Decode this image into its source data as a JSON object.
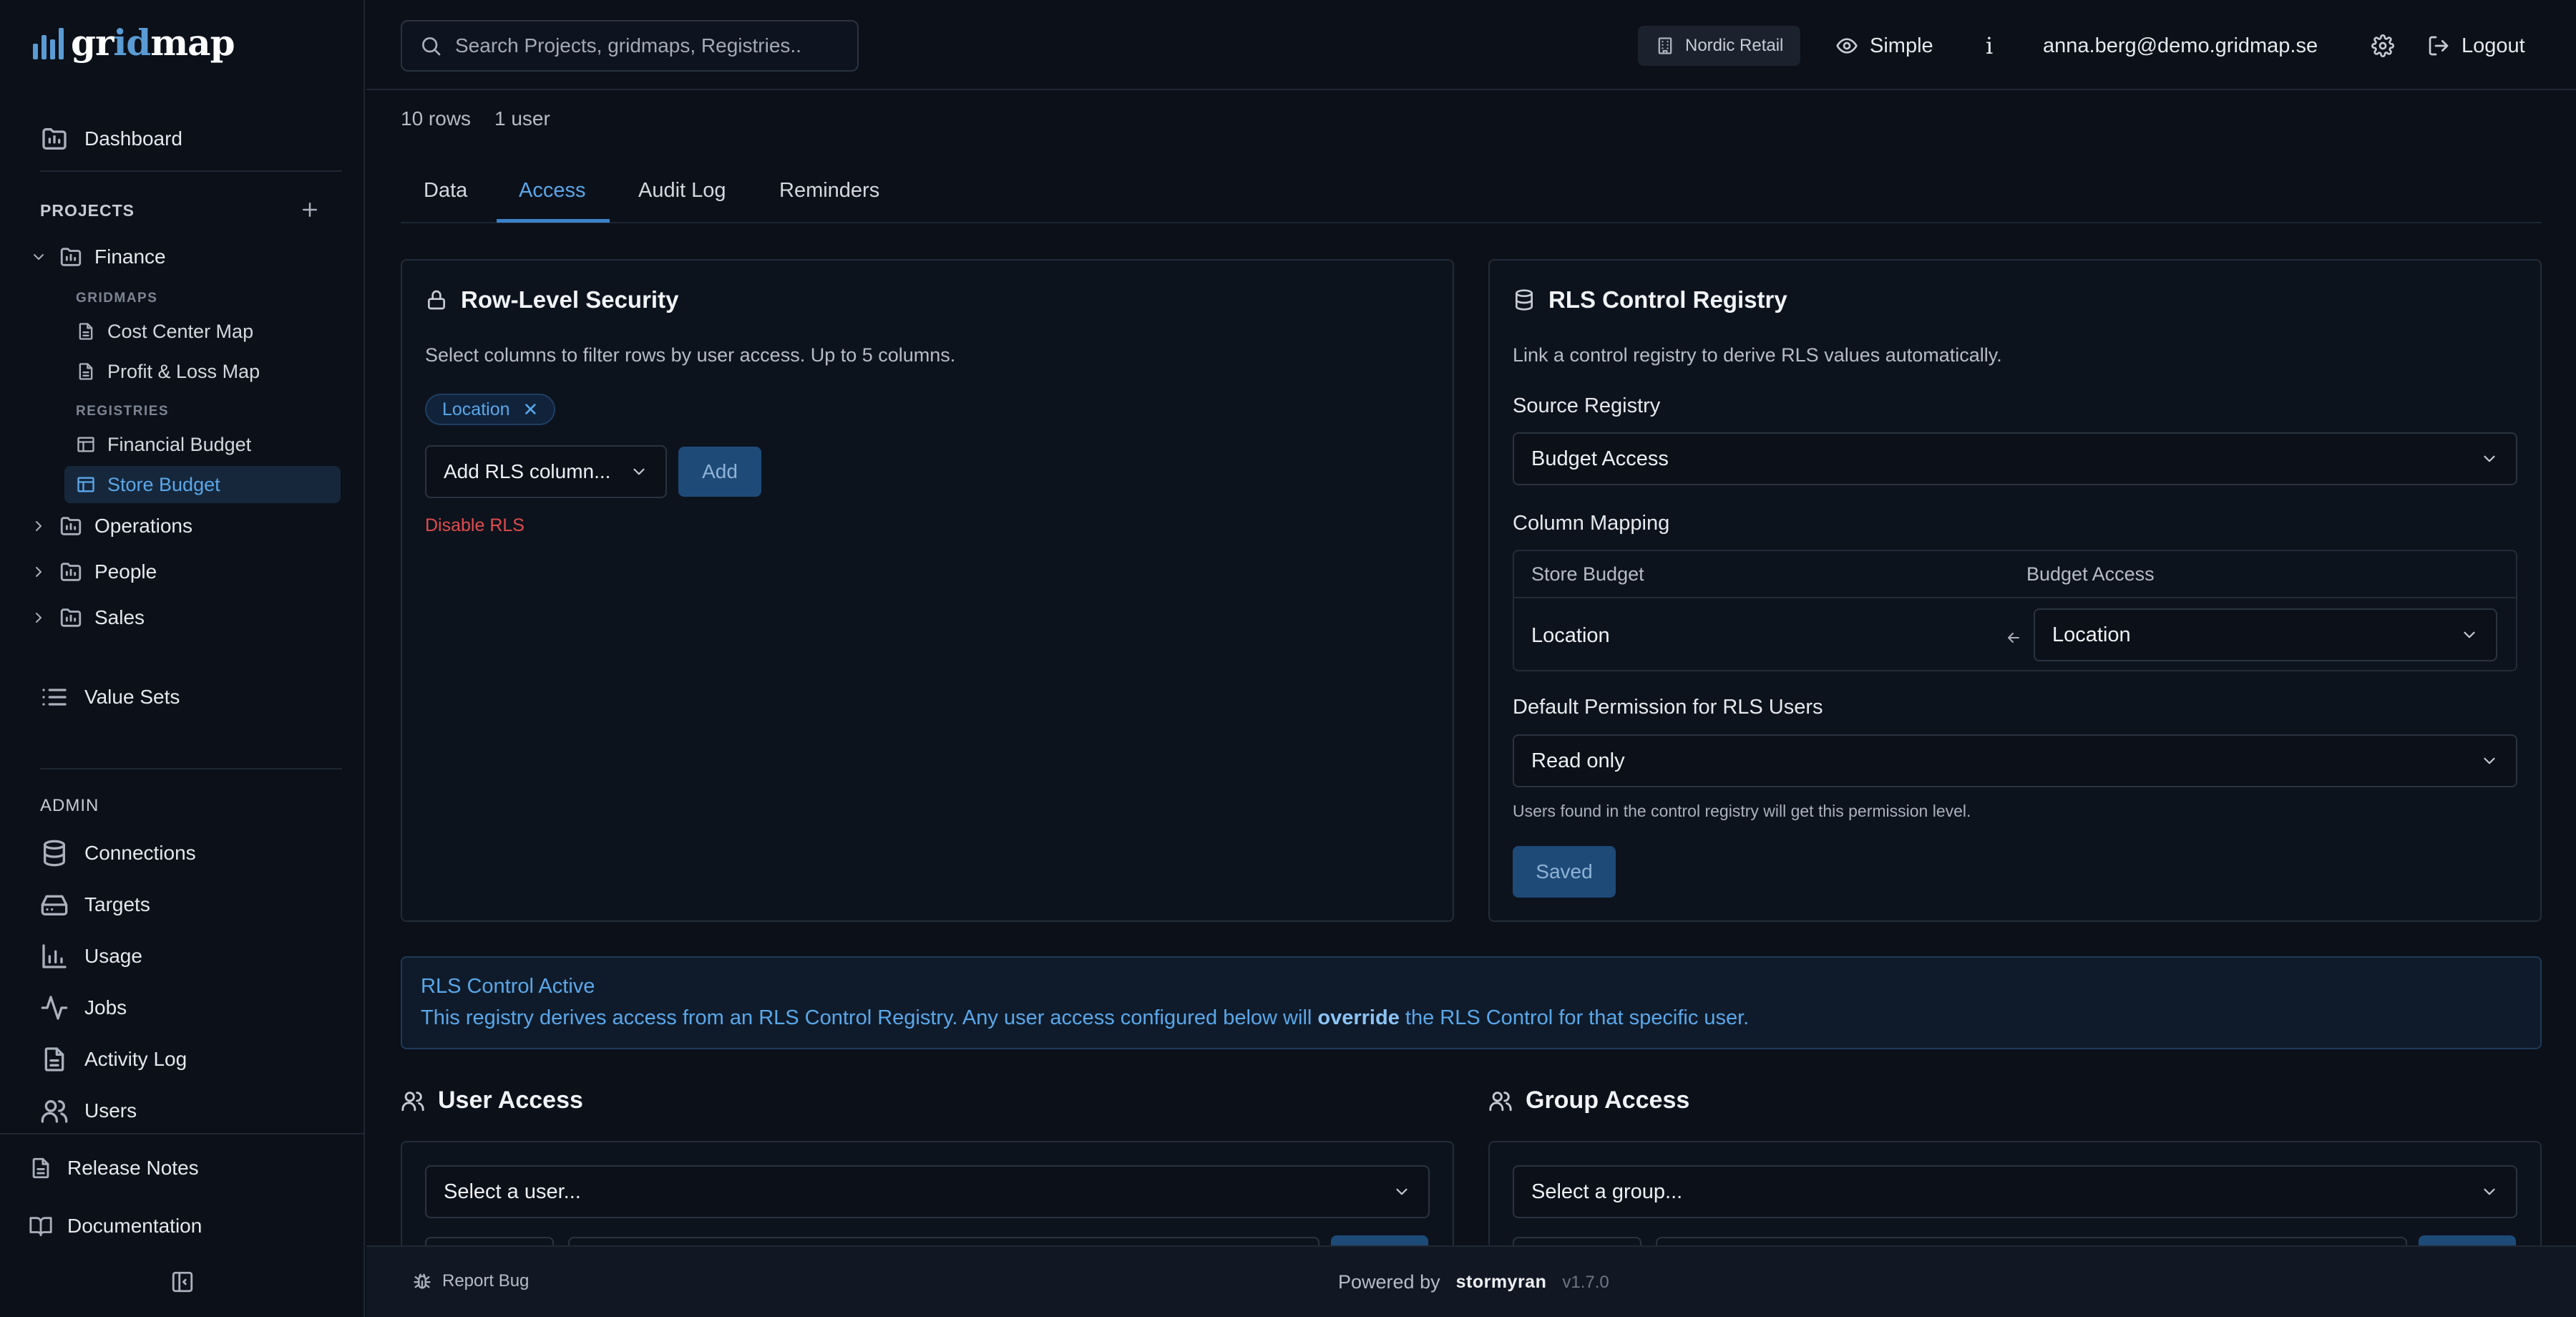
{
  "app": {
    "logo_part1": "gr",
    "logo_accent": "id",
    "logo_part2": "map"
  },
  "header": {
    "search_placeholder": "Search Projects, gridmaps, Registries..",
    "org": "Nordic Retail",
    "view_mode": "Simple",
    "info": "i",
    "user_email": "anna.berg@demo.gridmap.se",
    "logout": "Logout"
  },
  "sidebar": {
    "dashboard": "Dashboard",
    "projects_label": "PROJECTS",
    "projects": [
      {
        "name": "Finance",
        "expanded": true
      },
      {
        "name": "Operations",
        "expanded": false
      },
      {
        "name": "People",
        "expanded": false
      },
      {
        "name": "Sales",
        "expanded": false
      }
    ],
    "gridmaps_label": "GRIDMAPS",
    "gridmaps": [
      "Cost Center Map",
      "Profit & Loss Map"
    ],
    "registries_label": "REGISTRIES",
    "registries": [
      "Financial Budget",
      "Store Budget"
    ],
    "value_sets": "Value Sets",
    "admin_label": "ADMIN",
    "admin_items": [
      "Connections",
      "Targets",
      "Usage",
      "Jobs",
      "Activity Log",
      "Users"
    ],
    "release_notes": "Release Notes",
    "documentation": "Documentation"
  },
  "meta": {
    "rows": "10 rows",
    "users": "1 user"
  },
  "tabs": [
    "Data",
    "Access",
    "Audit Log",
    "Reminders"
  ],
  "active_tab": "Access",
  "rls": {
    "title": "Row-Level Security",
    "description": "Select columns to filter rows by user access. Up to 5 columns.",
    "chip": "Location",
    "chip_remove": "✕",
    "add_select": "Add RLS column...",
    "add_button": "Add",
    "disable": "Disable RLS"
  },
  "registry": {
    "title": "RLS Control Registry",
    "description": "Link a control registry to derive RLS values automatically.",
    "source_label": "Source Registry",
    "source_value": "Budget Access",
    "mapping_label": "Column Mapping",
    "mapping_col_left": "Store Budget",
    "mapping_col_right": "Budget Access",
    "mapping_row_left": "Location",
    "mapping_row_right": "Location",
    "perm_label": "Default Permission for RLS Users",
    "perm_value": "Read only",
    "hint": "Users found in the control registry will get this permission level.",
    "saved": "Saved"
  },
  "alert": {
    "title": "RLS Control Active",
    "text_before": "This registry derives access from an RLS Control Registry. Any user access configured below will ",
    "text_bold": "override",
    "text_after": " the RLS Control for that specific user."
  },
  "user_access": {
    "title": "User Access",
    "select": "Select a user..."
  },
  "group_access": {
    "title": "Group Access",
    "select": "Select a group..."
  },
  "footer": {
    "report_bug": "Report Bug",
    "powered_by": "Powered by",
    "brand": "stormyran",
    "version": "v1.7.0"
  },
  "colors": {
    "accent": "#5aa7ea",
    "background": "#0b1019",
    "danger": "#e04c4c",
    "button": "#1e4a78"
  }
}
